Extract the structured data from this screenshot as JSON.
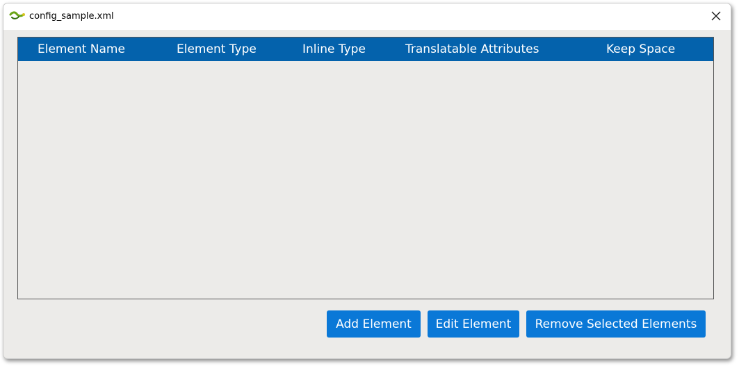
{
  "window": {
    "title": "config_sample.xml",
    "app_icon": "green-snake-icon",
    "close_icon": "close-icon"
  },
  "table": {
    "columns": [
      "Element Name",
      "Element Type",
      "Inline Type",
      "Translatable Attributes",
      "Keep Space"
    ],
    "rows": []
  },
  "buttons": {
    "add": "Add Element",
    "edit": "Edit Element",
    "remove": "Remove Selected Elements"
  },
  "colors": {
    "header_bg": "#0462ac",
    "button_bg": "#0a78d7",
    "window_bg": "#ecebe9"
  }
}
